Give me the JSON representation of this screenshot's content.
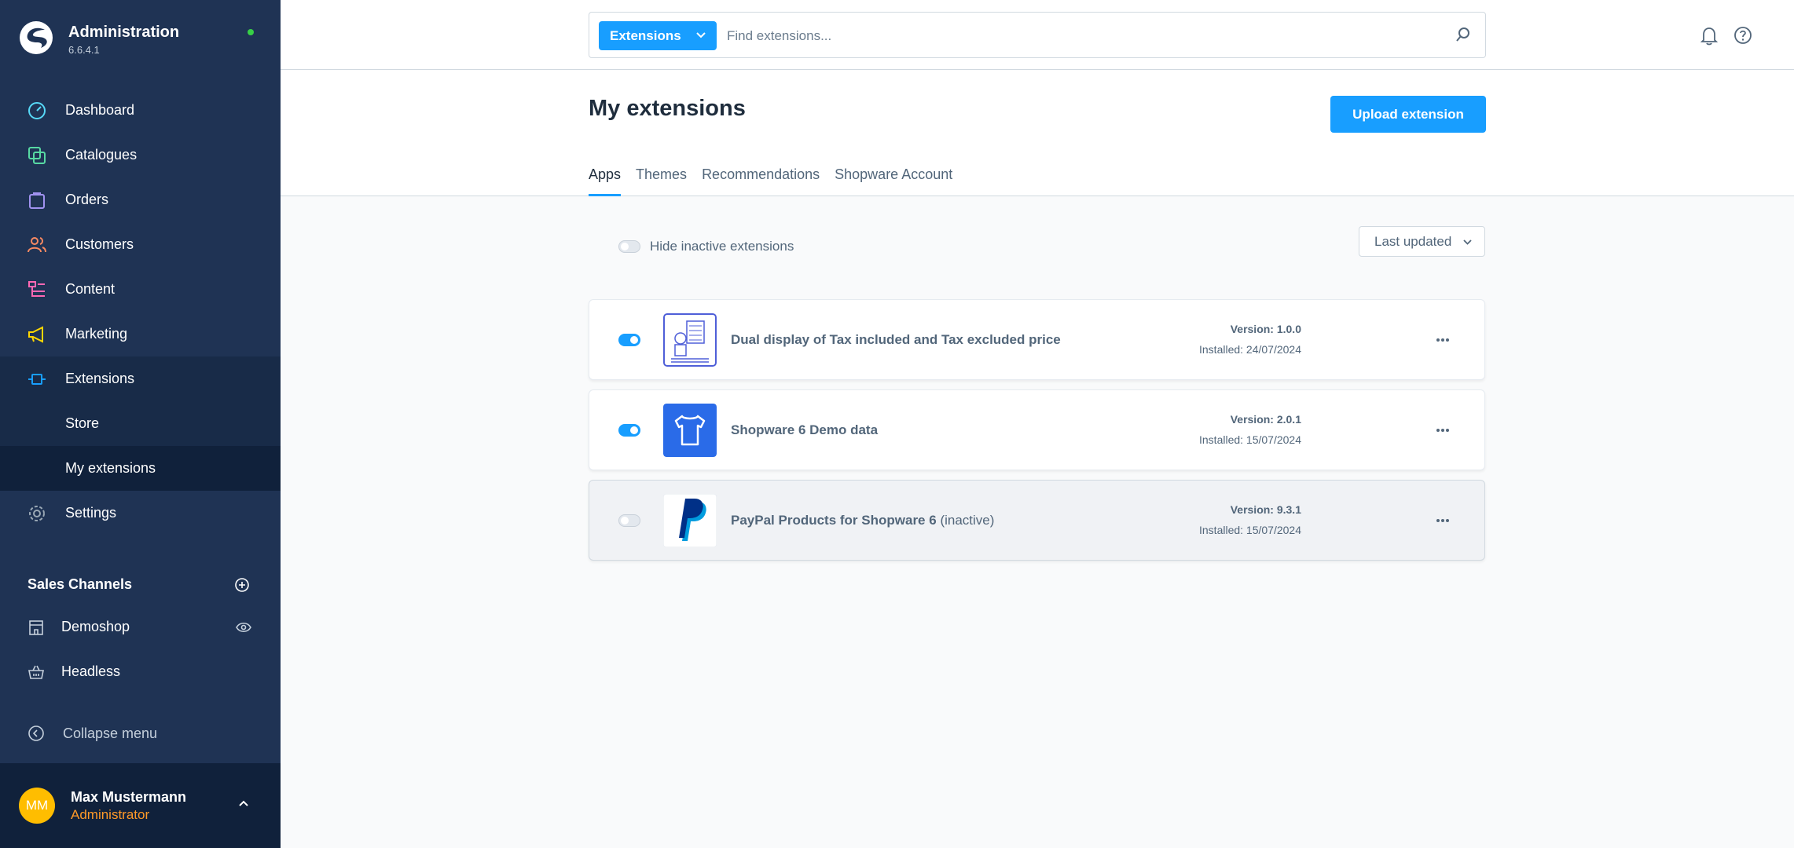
{
  "brand": {
    "title": "Administration",
    "version": "6.6.4.1",
    "status_color": "#37d046"
  },
  "nav": {
    "items": [
      {
        "label": "Dashboard",
        "icon": "dashboard-icon",
        "color": "#57d9f7"
      },
      {
        "label": "Catalogues",
        "icon": "catalogue-icon",
        "color": "#57d9a3"
      },
      {
        "label": "Orders",
        "icon": "orders-icon",
        "color": "#a092f0"
      },
      {
        "label": "Customers",
        "icon": "customers-icon",
        "color": "#f88962"
      },
      {
        "label": "Content",
        "icon": "content-icon",
        "color": "#ff68b4"
      },
      {
        "label": "Marketing",
        "icon": "marketing-icon",
        "color": "#ffd700"
      },
      {
        "label": "Extensions",
        "icon": "extensions-icon",
        "color": "#189eff"
      },
      {
        "label": "Settings",
        "icon": "settings-icon",
        "color": "#9aa8b5"
      }
    ],
    "sub_items": [
      {
        "label": "Store"
      },
      {
        "label": "My extensions"
      }
    ]
  },
  "sales_channels": {
    "title": "Sales Channels",
    "items": [
      {
        "label": "Demoshop"
      },
      {
        "label": "Headless"
      }
    ]
  },
  "collapse_label": "Collapse menu",
  "user": {
    "initials": "MM",
    "name": "Max Mustermann",
    "role": "Administrator"
  },
  "search": {
    "type_label": "Extensions",
    "placeholder": "Find extensions..."
  },
  "page": {
    "title": "My extensions",
    "upload_label": "Upload extension",
    "tabs": [
      {
        "label": "Apps"
      },
      {
        "label": "Themes"
      },
      {
        "label": "Recommendations"
      },
      {
        "label": "Shopware Account"
      }
    ]
  },
  "filters": {
    "hide_inactive_label": "Hide inactive extensions",
    "sort_label": "Last updated"
  },
  "extensions": [
    {
      "name": "Dual display of Tax included and Tax excluded price",
      "status": "",
      "version": "Version: 1.0.0",
      "installed": "Installed: 24/07/2024",
      "active": true
    },
    {
      "name": "Shopware 6 Demo data",
      "status": "",
      "version": "Version: 2.0.1",
      "installed": "Installed: 15/07/2024",
      "active": true
    },
    {
      "name": "PayPal Products for Shopware 6",
      "status": "(inactive)",
      "version": "Version: 9.3.1",
      "installed": "Installed: 15/07/2024",
      "active": false
    }
  ]
}
